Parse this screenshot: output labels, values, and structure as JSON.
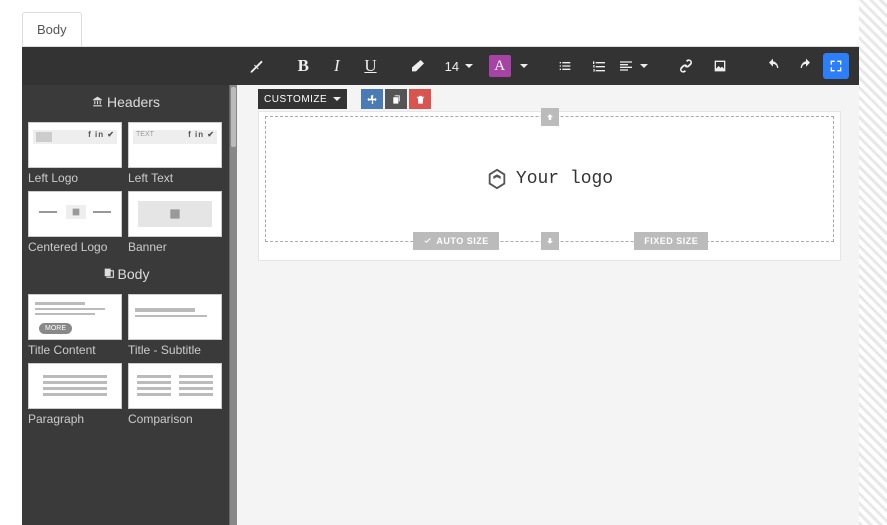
{
  "tabs": {
    "body": "Body"
  },
  "toolbar": {
    "font_size": "14",
    "bold": "B",
    "italic": "I",
    "underline": "U",
    "font_color_glyph": "A"
  },
  "customize": {
    "label": "CUSTOMIZE"
  },
  "sidebar": {
    "section_headers": "Headers",
    "section_body": "Body",
    "items": [
      {
        "label": "Left Logo"
      },
      {
        "label": "Left Text",
        "text_badge": "TEXT"
      },
      {
        "label": "Centered Logo"
      },
      {
        "label": "Banner"
      },
      {
        "label": "Title Content",
        "more": "MORE"
      },
      {
        "label": "Title - Subtitle"
      },
      {
        "label": "Paragraph"
      },
      {
        "label": "Comparison"
      }
    ]
  },
  "canvas": {
    "logo_text": "Your logo",
    "auto_size": "AUTO SIZE",
    "fixed_size": "FIXED SIZE"
  }
}
